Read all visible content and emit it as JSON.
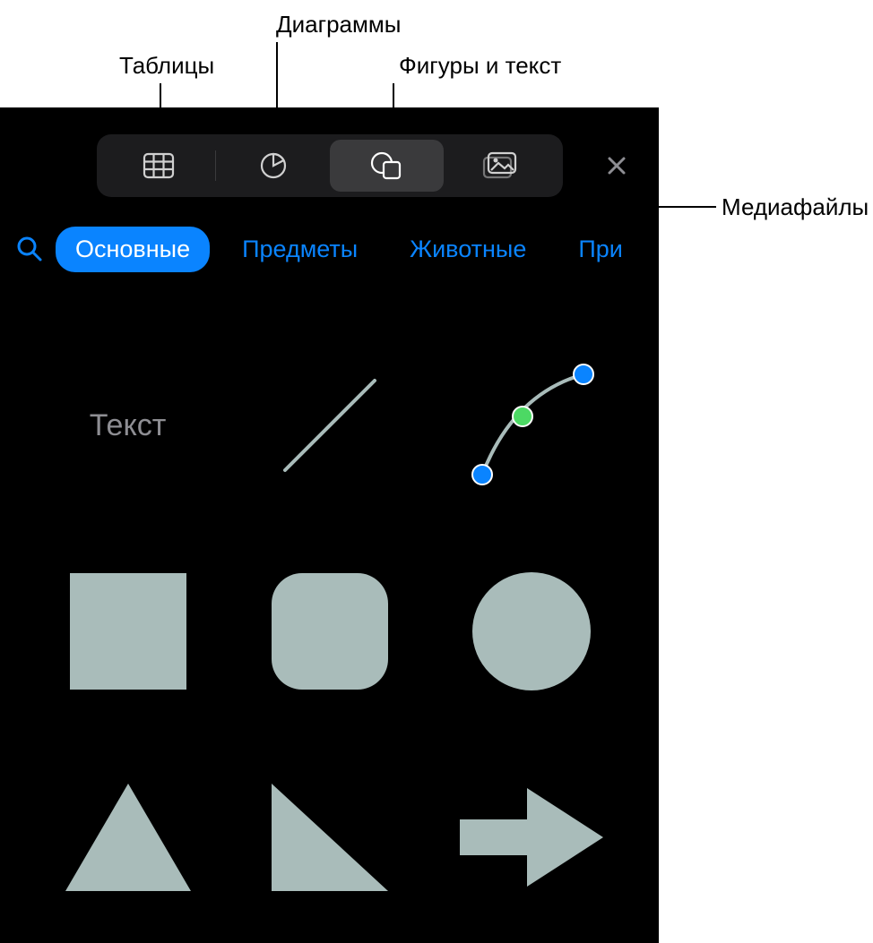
{
  "callouts": {
    "tables": "Таблицы",
    "charts": "Диаграммы",
    "shapes_text": "Фигуры и текст",
    "media": "Медиафайлы"
  },
  "toolbar": {
    "tables_icon": "table-icon",
    "charts_icon": "pie-chart-icon",
    "shapes_icon": "shapes-icon",
    "media_icon": "photo-icon",
    "close_icon": "close-icon"
  },
  "categories": {
    "search_icon": "search-icon",
    "items": [
      {
        "label": "Основные",
        "active": true
      },
      {
        "label": "Предметы",
        "active": false
      },
      {
        "label": "Животные",
        "active": false
      },
      {
        "label": "При",
        "active": false
      }
    ]
  },
  "shapes": {
    "text_label": "Текст",
    "items": [
      "text",
      "line",
      "curve-pen",
      "square",
      "rounded-square",
      "circle",
      "triangle",
      "right-triangle",
      "arrow-right"
    ]
  },
  "colors": {
    "accent": "#0a84ff",
    "shape_fill": "#a9bcba",
    "node_green": "#4cd964",
    "node_blue": "#0a84ff"
  }
}
